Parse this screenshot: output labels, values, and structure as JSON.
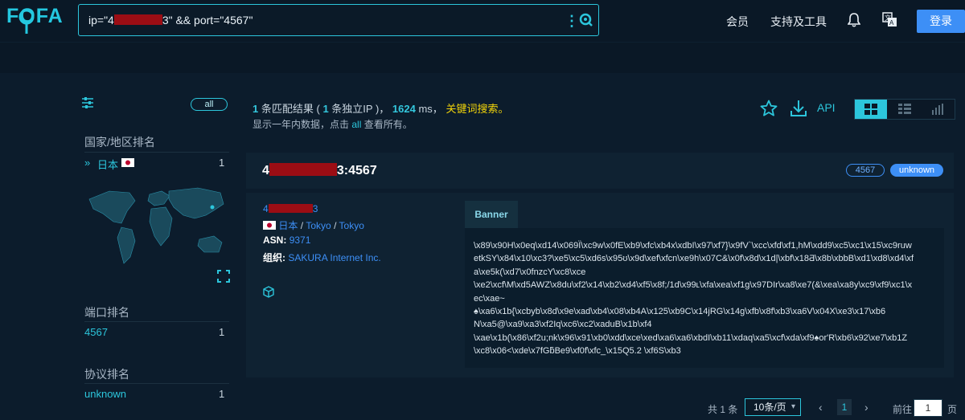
{
  "header": {
    "logo": "FOFA",
    "search_pre": "ip=\"4",
    "search_post": "3\" && port=\"4567\"",
    "nav": [
      "会员",
      "支持及工具"
    ],
    "login": "登录"
  },
  "sidebar": {
    "all": "all",
    "country_heading": "国家/地区排名",
    "countries": [
      {
        "name": "日本",
        "count": "1"
      }
    ],
    "port_heading": "端口排名",
    "ports": [
      {
        "name": "4567",
        "count": "1"
      }
    ],
    "protocol_heading": "协议排名",
    "protocols": [
      {
        "name": "unknown",
        "count": "1"
      }
    ]
  },
  "summary": {
    "count": "1",
    "t1": "条匹配结果 (",
    "ipcount": "1",
    "t2": "条独立IP )，",
    "ms": "1624",
    "t3": "ms，",
    "keyword": "关键词搜索。",
    "line2_a": "显示一年内数据，点击",
    "line2_all": "all",
    "line2_b": "查看所有。",
    "api": "API"
  },
  "result": {
    "host_pre": "4",
    "host_post": "3:4567",
    "port_tag": "4567",
    "protocol_tag": "unknown",
    "ip_pre": "4",
    "ip_post": "3",
    "country": "日本",
    "region": "Tokyo",
    "city": "Tokyo",
    "asn_label": "ASN:",
    "asn": "9371",
    "org_label": "组织:",
    "org": "SAKURA Internet Inc.",
    "banner_tab": "Banner",
    "banner_lines": [
      "\\x89\\x90H\\x0eq\\xd14\\x069Ï\\xc9w\\x0fE\\xb9\\xfc\\xb4x\\xdbI\\x97\\xf7}\\x9fV`\\xcc\\xfd\\xf1,hM\\xdd9\\xc5\\xc1\\x15\\xc9ruw",
      "etkSY\\x84\\x10\\xc3?\\xe5\\xc5\\xd6s\\x95ʊ\\x9d\\xef\\xfcn\\xe9h\\x07C&\\x0f\\x8d\\x1d|\\xbf\\x18Ƌ\\x8b\\xbbB\\xd1\\xd8\\xd4\\xf",
      "a\\xe5k(\\xd7\\x0fnzcY\\xc8\\xce",
      "\\xe2\\xcf\\M\\xd5AWZ\\x8du\\xf2\\x14\\xb2\\xd4\\xf5\\x8f;/1d\\x99ʟ\\xfa\\xea\\xf1g\\x97DIr\\xa8\\xe7(&\\xea\\xa8y\\xc9\\xf9\\xc1\\x",
      "ec\\xae~",
      "♠\\xa6\\x1b{\\xcbyb\\x8d\\x9e\\xad\\xb4\\x08\\xb4A\\x125\\xb9C\\x14jRG\\x14g\\xfb\\x8f\\xb3\\xa6V\\x04X\\xe3\\x17\\xb6",
      "N\\xa5@\\xa9\\xa3\\xf2Iq\\xc6\\xc2\\xaduB\\x1b\\xf4",
      "\\xae\\x1b(\\x86\\xf2u;nk\\x96\\x91\\xb0\\xdd\\xce\\xed\\xa6\\xa6\\xbdI\\xb11\\xdaq\\xa5\\xcf\\xda\\xf9♠or'R\\xb6\\x92\\xe7\\xb1Z",
      "\\xc8\\x06<\\xde\\x7fGƃBe9\\xf0f\\xfc_\\x15Q5.2 \\xf6S\\xb3"
    ]
  },
  "pagination": {
    "total": "共 1 条",
    "page_size": "10条/页",
    "current": "1",
    "goto_label": "前往",
    "goto_value": "1",
    "page_suffix": "页"
  },
  "colors": {
    "accent": "#2cc6dc",
    "brand_blue": "#3d8ff6",
    "highlight": "#f2d40a",
    "redaction": "#9b0d14"
  },
  "icons": [
    "fofa-logo-icon",
    "kebab-icon",
    "search-icon",
    "bell-icon",
    "translate-icon",
    "filter-icon",
    "chevrons-right-icon",
    "japan-flag-icon",
    "world-map",
    "expand-icon",
    "star-icon",
    "download-icon",
    "grid-view-icon",
    "list-view-icon",
    "chart-view-icon",
    "cube-icon",
    "chevron-down-icon",
    "chevron-left-icon",
    "chevron-right-icon"
  ]
}
